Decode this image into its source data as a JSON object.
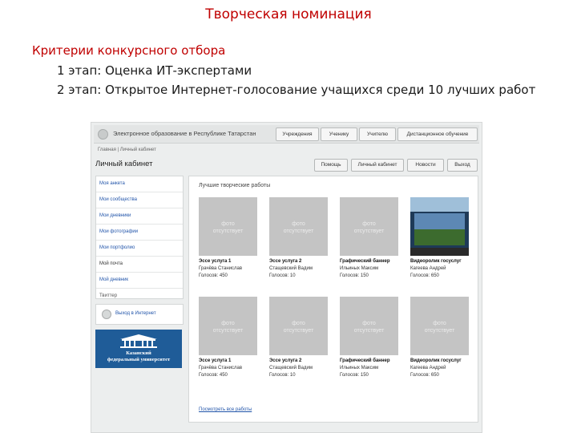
{
  "slide": {
    "title": "Творческая номинация",
    "criteria_heading": "Критерии конкурсного отбора",
    "stage1": "1 этап: Оценка ИТ-экспертами",
    "stage2": "2 этап: Открытое Интернет-голосование учащихся среди 10 лучших работ"
  },
  "screenshot": {
    "site_name": "Электронное образование в Республике Татарстан",
    "nav": [
      "Учреждения",
      "Ученику",
      "Учителю",
      "Дистанционное обучение"
    ],
    "breadcrumb": "Главная  |  Личный кабинет",
    "page_title": "Личный кабинет",
    "header_buttons": [
      "Помощь",
      "Личный кабинет",
      "Новости",
      "Выход"
    ],
    "side_menu": [
      "Моя анкета",
      "Мои сообщества",
      "Мои дневники",
      "Мои фотографии",
      "Мои портфолио",
      "Мой почта",
      "Мой дневник",
      "Твиттер"
    ],
    "exit_label": "Выход в Интернет",
    "kfu_text": [
      "Казанский",
      "федеральный университет"
    ],
    "panel_title": "Лучшие творческие работы",
    "placeholder": [
      "фото",
      "отсутствует"
    ],
    "cards_row1": [
      {
        "title": "Эссе услуга 1",
        "author": "Грачёва Станислав",
        "votes": "Голосов: 450"
      },
      {
        "title": "Эссе услуга 2",
        "author": "Стащевский Вадим",
        "votes": "Голосов: 10"
      },
      {
        "title": "Графический баннер",
        "author": "Ильиных Максим",
        "votes": "Голосов: 150"
      },
      {
        "title": "Видеоролик госуслуг",
        "author": "Кагеева Андрей",
        "votes": "Голосов: 650"
      }
    ],
    "cards_row2": [
      {
        "title": "Эссе услуга 1",
        "author": "Грачёва Станислав",
        "votes": "Голосов: 450"
      },
      {
        "title": "Эссе услуга 2",
        "author": "Стащевский Вадим",
        "votes": "Голосов: 10"
      },
      {
        "title": "Графический баннер",
        "author": "Ильиных Максим",
        "votes": "Голосов: 150"
      },
      {
        "title": "Видеоролик госуслуг",
        "author": "Кагеева Андрей",
        "votes": "Голосов: 650"
      }
    ],
    "more_link": "Посмотреть все работы"
  }
}
